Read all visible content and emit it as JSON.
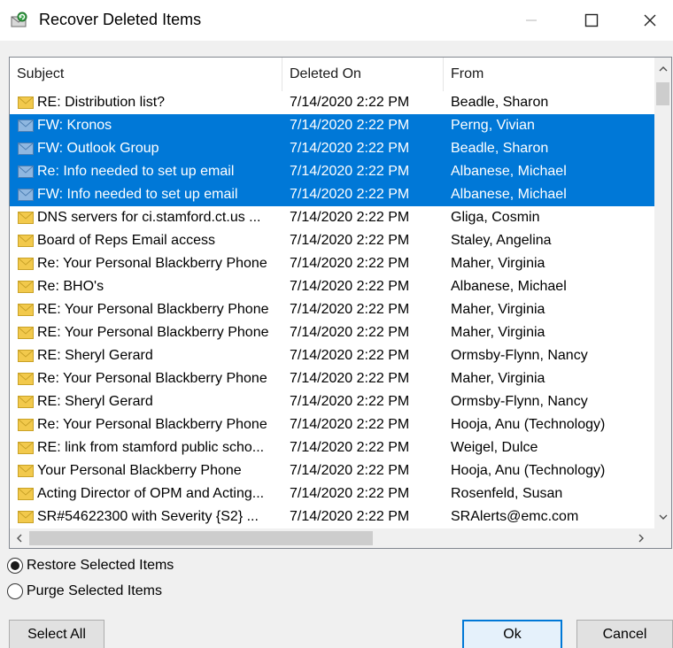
{
  "window": {
    "title": "Recover Deleted Items"
  },
  "columns": {
    "subject": "Subject",
    "deleted_on": "Deleted On",
    "from": "From"
  },
  "rows": [
    {
      "subject": "RE: Distribution list?",
      "deleted_on": "7/14/2020 2:22 PM",
      "from": "Beadle, Sharon",
      "selected": false
    },
    {
      "subject": "FW: Kronos",
      "deleted_on": "7/14/2020 2:22 PM",
      "from": "Perng, Vivian",
      "selected": true
    },
    {
      "subject": "FW: Outlook Group",
      "deleted_on": "7/14/2020 2:22 PM",
      "from": "Beadle, Sharon",
      "selected": true
    },
    {
      "subject": "Re: Info needed to set up email",
      "deleted_on": "7/14/2020 2:22 PM",
      "from": "Albanese, Michael",
      "selected": true
    },
    {
      "subject": "FW: Info needed to set up email",
      "deleted_on": "7/14/2020 2:22 PM",
      "from": "Albanese, Michael",
      "selected": true
    },
    {
      "subject": "DNS servers for ci.stamford.ct.us ...",
      "deleted_on": "7/14/2020 2:22 PM",
      "from": "Gliga, Cosmin",
      "selected": false
    },
    {
      "subject": "Board of Reps Email access",
      "deleted_on": "7/14/2020 2:22 PM",
      "from": "Staley, Angelina",
      "selected": false
    },
    {
      "subject": "Re: Your Personal Blackberry Phone",
      "deleted_on": "7/14/2020 2:22 PM",
      "from": "Maher, Virginia",
      "selected": false
    },
    {
      "subject": "Re: BHO's",
      "deleted_on": "7/14/2020 2:22 PM",
      "from": "Albanese, Michael",
      "selected": false
    },
    {
      "subject": "RE: Your Personal Blackberry Phone",
      "deleted_on": "7/14/2020 2:22 PM",
      "from": "Maher, Virginia",
      "selected": false
    },
    {
      "subject": "RE: Your Personal Blackberry Phone",
      "deleted_on": "7/14/2020 2:22 PM",
      "from": "Maher, Virginia",
      "selected": false
    },
    {
      "subject": "RE: Sheryl Gerard",
      "deleted_on": "7/14/2020 2:22 PM",
      "from": "Ormsby-Flynn, Nancy",
      "selected": false
    },
    {
      "subject": "Re: Your Personal Blackberry Phone",
      "deleted_on": "7/14/2020 2:22 PM",
      "from": "Maher, Virginia",
      "selected": false
    },
    {
      "subject": "RE: Sheryl Gerard",
      "deleted_on": "7/14/2020 2:22 PM",
      "from": "Ormsby-Flynn, Nancy",
      "selected": false
    },
    {
      "subject": "Re: Your Personal Blackberry Phone",
      "deleted_on": "7/14/2020 2:22 PM",
      "from": "Hooja, Anu (Technology)",
      "selected": false
    },
    {
      "subject": "RE: link from stamford public scho...",
      "deleted_on": "7/14/2020 2:22 PM",
      "from": "Weigel, Dulce",
      "selected": false
    },
    {
      "subject": "Your Personal Blackberry Phone",
      "deleted_on": "7/14/2020 2:22 PM",
      "from": "Hooja, Anu (Technology)",
      "selected": false
    },
    {
      "subject": "Acting Director of OPM and Acting...",
      "deleted_on": "7/14/2020 2:22 PM",
      "from": "Rosenfeld, Susan",
      "selected": false
    },
    {
      "subject": "SR#54622300 with Severity {S2} ...",
      "deleted_on": "7/14/2020 2:22 PM",
      "from": "SRAlerts@emc.com",
      "selected": false
    }
  ],
  "options": {
    "restore_label": "Restore Selected Items",
    "purge_label": "Purge Selected Items",
    "selected": "restore"
  },
  "buttons": {
    "select_all": "Select All",
    "ok": "Ok",
    "cancel": "Cancel"
  },
  "colors": {
    "selection": "#0078d7",
    "envelope": "#f2c94c",
    "envelope_selected": "#8fb7e0"
  },
  "icons": {
    "app": "recover-items-icon",
    "row": "envelope-icon"
  }
}
